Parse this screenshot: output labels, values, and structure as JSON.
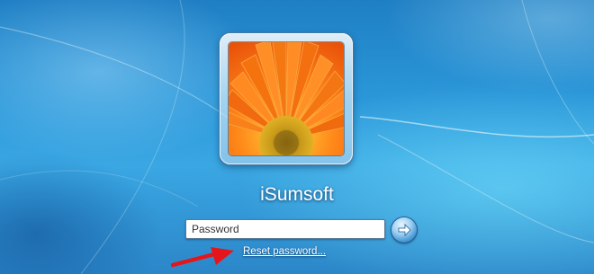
{
  "login": {
    "username": "iSumsoft",
    "password_placeholder": "Password",
    "reset_link": "Reset password..."
  },
  "icons": {
    "avatar": "orange-gerbera-flower",
    "submit": "right-arrow-icon",
    "pointer": "red-arrow-icon"
  },
  "colors": {
    "background": "#2a96d8",
    "annotation_arrow": "#e4161b",
    "flower_petals": "#f47b12",
    "flower_center": "#d8a312"
  }
}
